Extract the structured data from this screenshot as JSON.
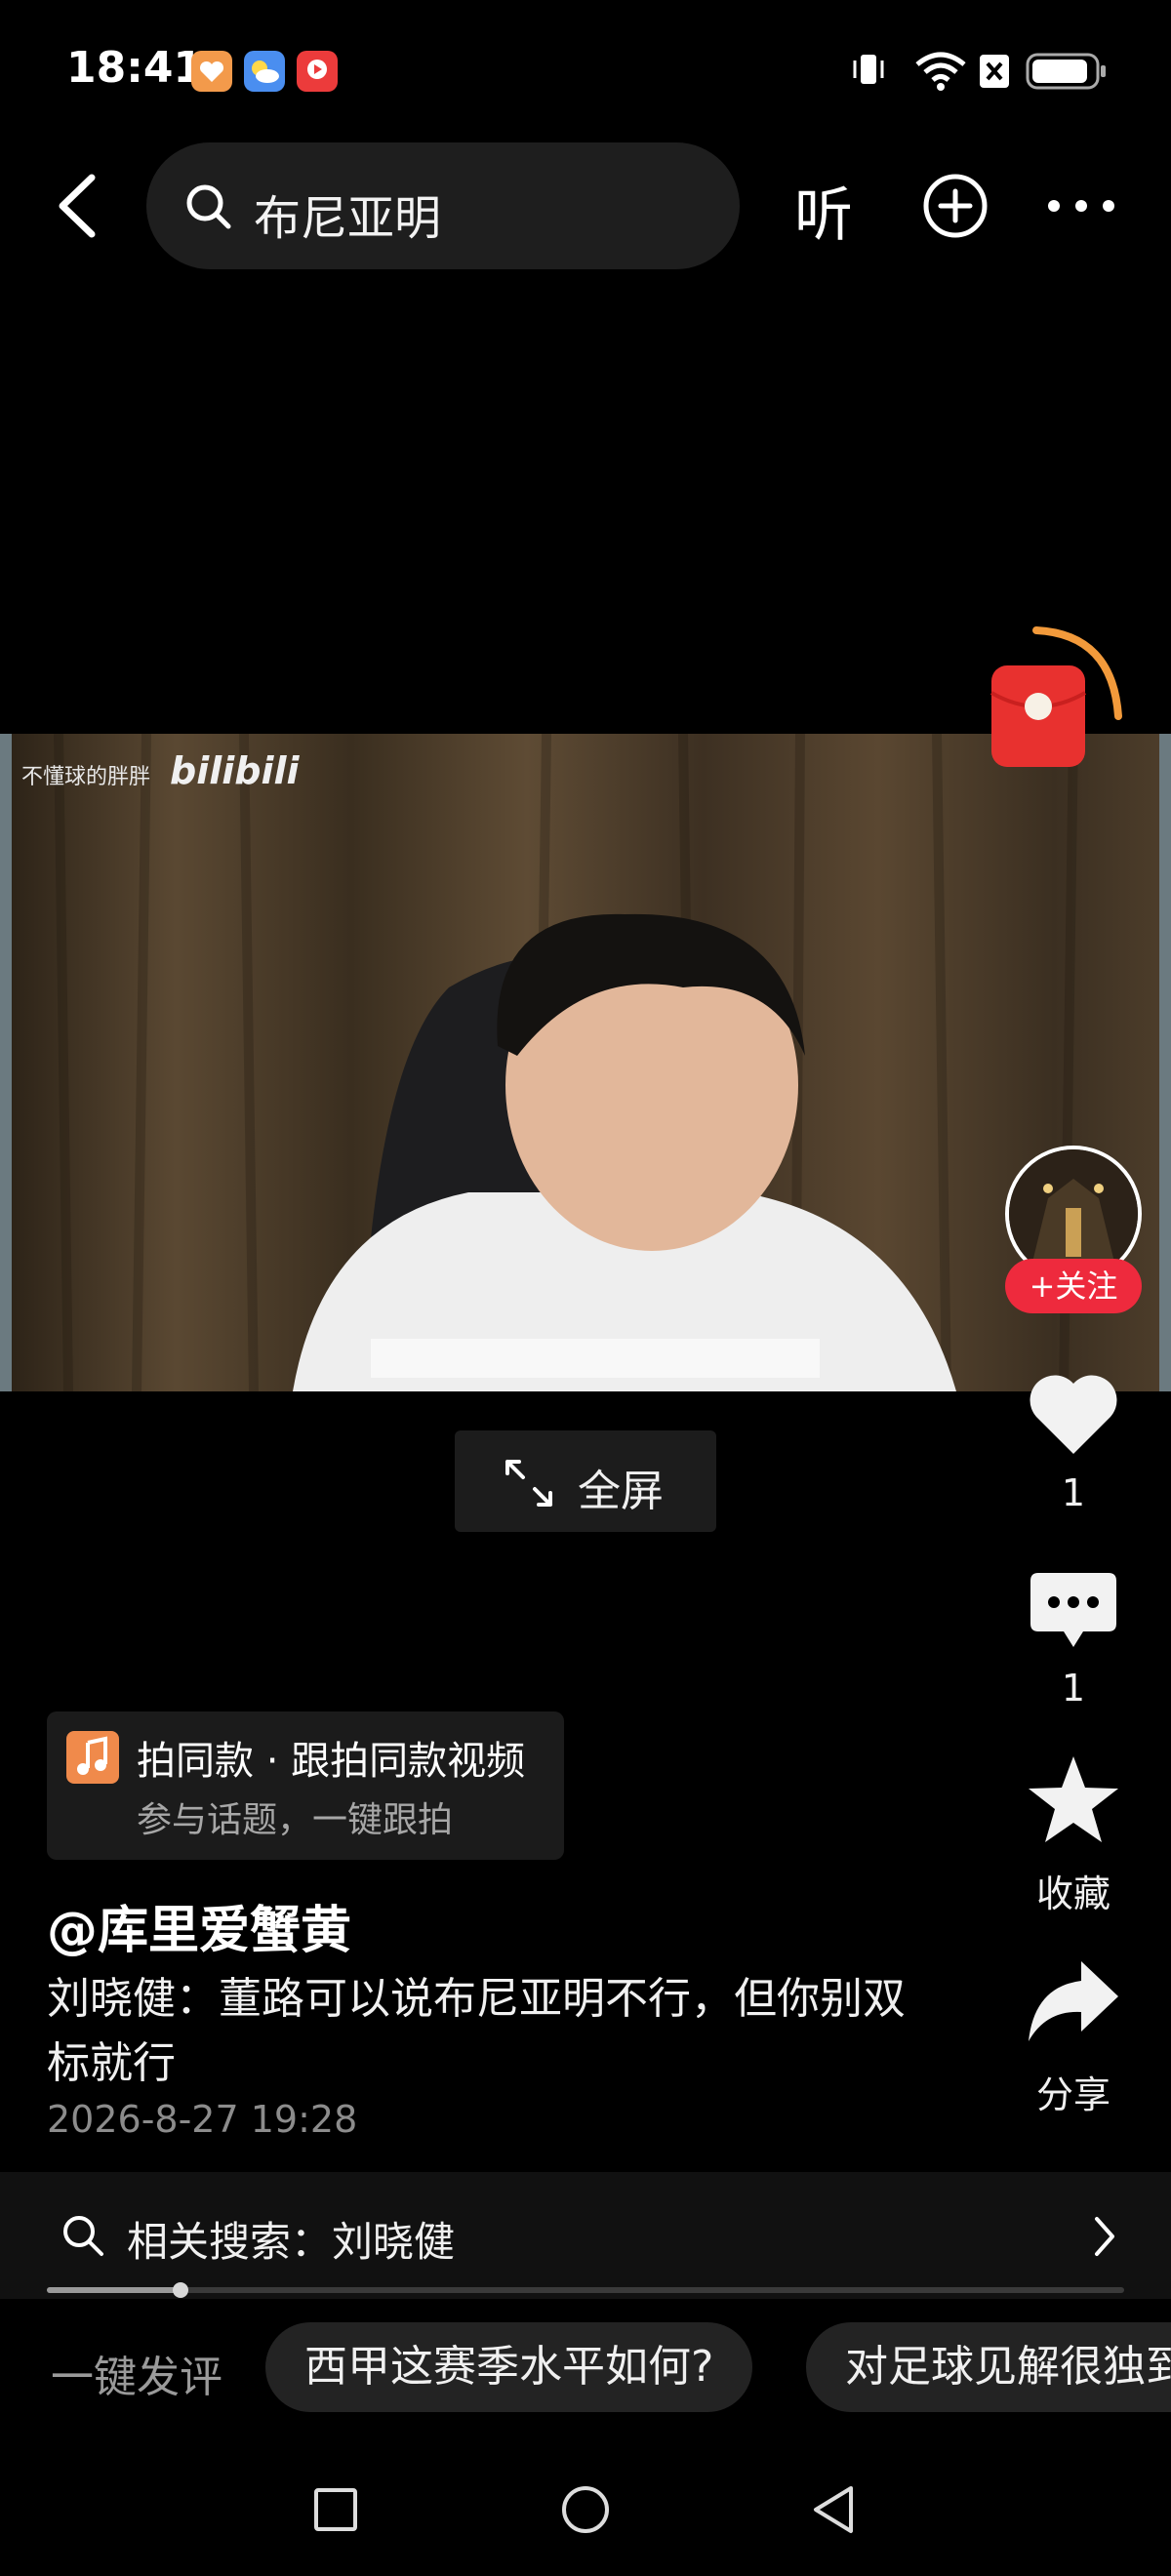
{
  "status_bar": {
    "time": "18:41",
    "notification_apps": [
      "health-app-icon",
      "weather-app-icon",
      "video-app-icon"
    ],
    "app_colors": [
      "#f39a4b",
      "#4a8ef0",
      "#ec3b3b"
    ],
    "right_icons": [
      "vibrate-icon",
      "wifi-icon",
      "sim-x-icon",
      "battery-icon"
    ]
  },
  "top_nav": {
    "search_query": "布尼亚明",
    "listen_label": "听"
  },
  "video": {
    "watermark_channel": "不懂球的胖胖",
    "watermark_logo": "bilibili"
  },
  "fullscreen_label": "全屏",
  "rail": {
    "follow_label": "+关注",
    "like_count": "1",
    "comment_count": "1",
    "favorite_label": "收藏",
    "share_label": "分享"
  },
  "challenge": {
    "title": "拍同款 · 跟拍同款视频",
    "subtitle": "参与话题，一键跟拍"
  },
  "post": {
    "author": "@库里爱蟹黄",
    "description": "刘晓健：董路可以说布尼亚明不行，但你别双标就行",
    "date": "2026-8-27 19:28"
  },
  "related_search": {
    "label": "相关搜索：刘晓健"
  },
  "playback": {
    "progress": 0.124
  },
  "comment_bar": {
    "quick_label": "一键发评",
    "chips": [
      "西甲这赛季水平如何?",
      "对足球见解很独到"
    ]
  },
  "colors": {
    "follow_red": "#ee2a3d",
    "background": "#000000"
  }
}
